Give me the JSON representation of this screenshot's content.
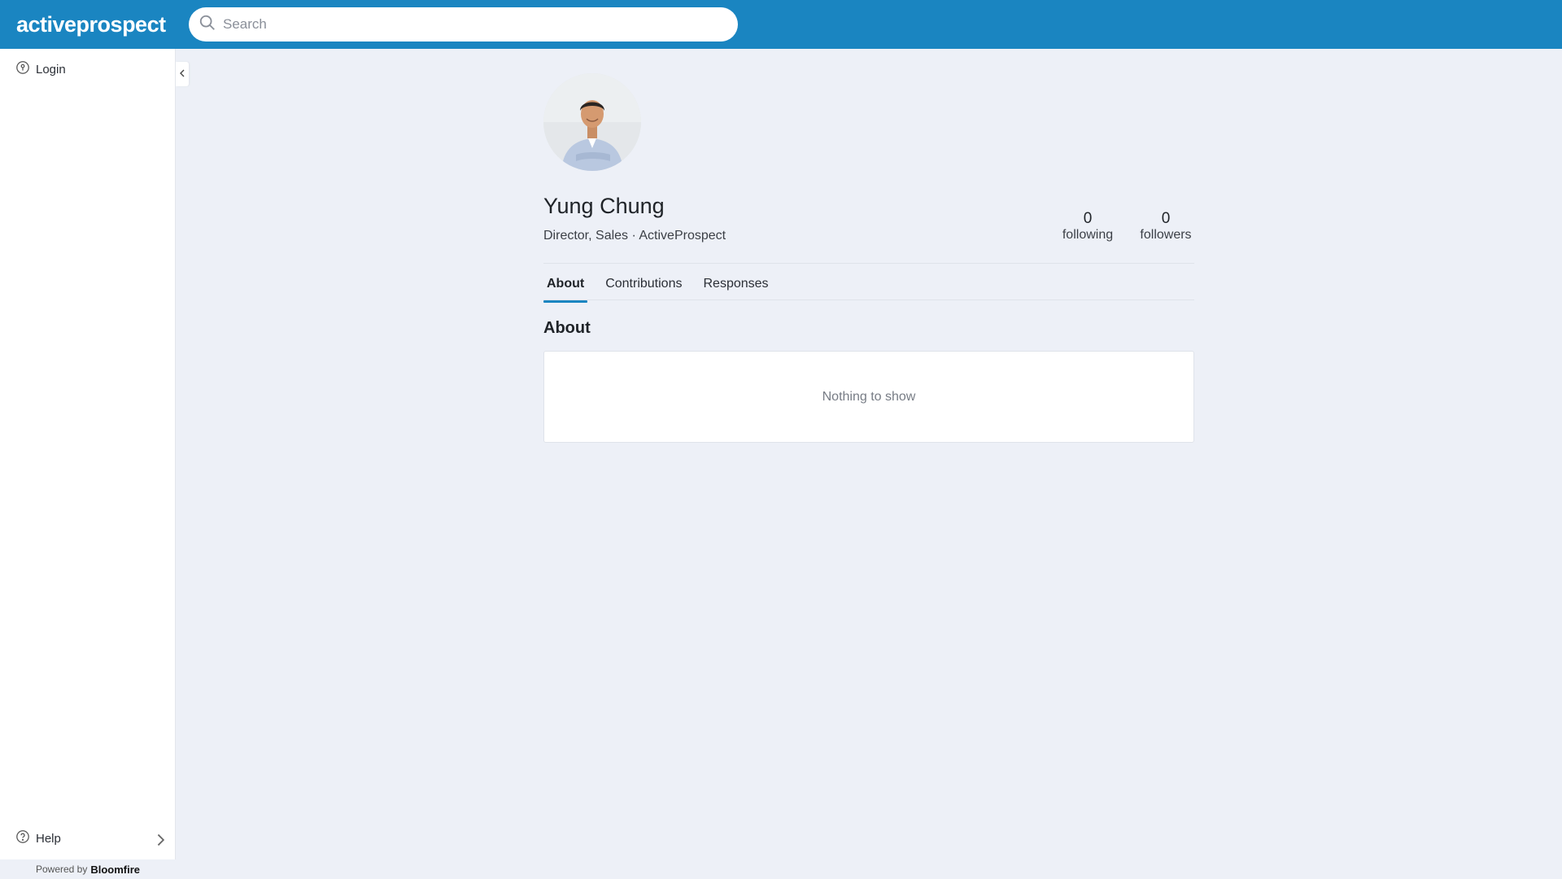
{
  "brand": {
    "logo_text": "activeprospect"
  },
  "search": {
    "placeholder": "Search"
  },
  "sidebar": {
    "login_label": "Login",
    "help_label": "Help",
    "powered_by_prefix": "Powered by",
    "powered_by_brand": "Bloomfire"
  },
  "profile": {
    "name": "Yung Chung",
    "subtitle": "Director, Sales · ActiveProspect",
    "following_count": "0",
    "following_label": "following",
    "followers_count": "0",
    "followers_label": "followers"
  },
  "tabs": [
    {
      "label": "About",
      "active": true
    },
    {
      "label": "Contributions",
      "active": false
    },
    {
      "label": "Responses",
      "active": false
    }
  ],
  "about": {
    "heading": "About",
    "empty_text": "Nothing to show"
  },
  "colors": {
    "topbar": "#1a85c1",
    "page_bg": "#edf0f7",
    "accent": "#1a85c1"
  }
}
